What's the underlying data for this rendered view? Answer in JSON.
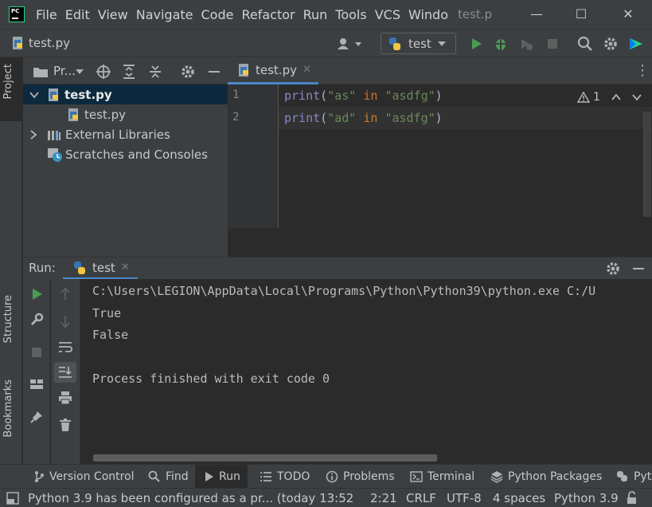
{
  "menubar": {
    "items": [
      "File",
      "Edit",
      "View",
      "Navigate",
      "Code",
      "Refactor",
      "Run",
      "Tools",
      "VCS",
      "Windo"
    ],
    "window_title": "test.p"
  },
  "navbar": {
    "file": "test.py",
    "run_config": "test"
  },
  "left_stripe": {
    "project": "Project",
    "structure": "Structure",
    "bookmarks": "Bookmarks"
  },
  "project_panel": {
    "title": "Pr...",
    "tree": [
      {
        "label": "test.py",
        "bold": true
      },
      {
        "label": "test.py"
      },
      {
        "label": "External Libraries"
      },
      {
        "label": "Scratches and Consoles"
      }
    ]
  },
  "editor": {
    "tab": "test.py",
    "line_numbers": [
      "1",
      "2"
    ],
    "lines": [
      {
        "fn": "print",
        "open": "(",
        "s1": "\"as\"",
        "kw": "in",
        "s2": "\"asdfg\"",
        "close": ")"
      },
      {
        "fn": "print",
        "open": "(",
        "s1": "\"ad\"",
        "kw": "in",
        "s2": "\"asdfg\"",
        "close": ")"
      }
    ],
    "warning_count": "1"
  },
  "run_panel": {
    "label": "Run:",
    "tab": "test",
    "console": [
      "C:\\Users\\LEGION\\AppData\\Local\\Programs\\Python\\Python39\\python.exe C:/U",
      "True",
      "False",
      "",
      "Process finished with exit code 0"
    ]
  },
  "bottom_tabs": [
    "Version Control",
    "Find",
    "Run",
    "TODO",
    "Problems",
    "Terminal",
    "Python Packages",
    "Pyth"
  ],
  "statusbar": {
    "message": "Python 3.9 has been configured as a pr... (today 13:52",
    "position": "2:21",
    "line_sep": "CRLF",
    "encoding": "UTF-8",
    "indent": "4 spaces",
    "interpreter": "Python 3.9"
  },
  "colors": {
    "accent": "#4a88c7",
    "run_green": "#499c54",
    "keyword": "#cc7832",
    "string": "#6a8759",
    "builtin": "#8888c6"
  }
}
